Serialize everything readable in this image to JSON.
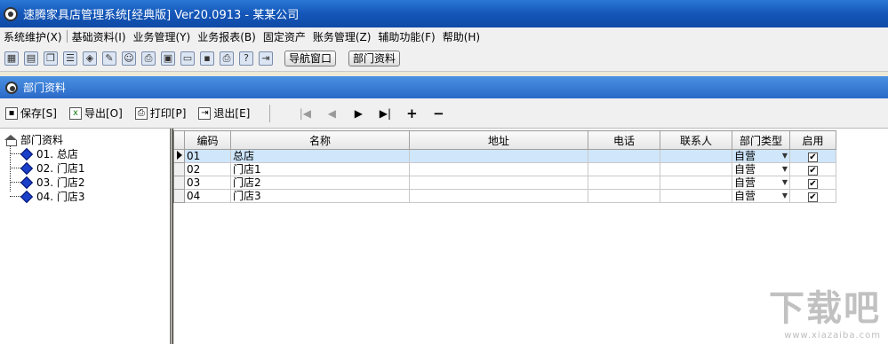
{
  "window": {
    "title": "速腾家具店管理系统[经典版] Ver20.0913  -  某某公司"
  },
  "menu": [
    "系统维护(X)",
    "基础资料(I)",
    "业务管理(Y)",
    "业务报表(B)",
    "固定资产",
    "账务管理(Z)",
    "辅助功能(F)",
    "帮助(H)"
  ],
  "toolbar": {
    "icons": [
      "grid-icon",
      "form-icon",
      "window-icon",
      "list-icon",
      "palette-icon",
      "tools-icon",
      "users-icon",
      "print-preview-icon",
      "folder-icon",
      "screen-icon",
      "save-icon",
      "printer-icon",
      "help-icon",
      "exit-icon"
    ],
    "nav_window_label": "导航窗口",
    "dept_label": "部门资料"
  },
  "subwindow": {
    "title": "部门资料"
  },
  "actions": {
    "save": "保存[S]",
    "export": "导出[O]",
    "print": "打印[P]",
    "exit": "退出[E]"
  },
  "nav": {
    "first": "|◀",
    "prev": "◀",
    "next": "▶",
    "last": "▶|",
    "add": "+",
    "delete": "−"
  },
  "tree": {
    "root": "部门资料",
    "nodes": [
      "01. 总店",
      "02. 门店1",
      "03. 门店2",
      "04. 门店3"
    ]
  },
  "grid": {
    "columns": [
      "编码",
      "名称",
      "地址",
      "电话",
      "联系人",
      "部门类型",
      "启用"
    ],
    "rows": [
      {
        "code": "01",
        "name": "总店",
        "address": "",
        "phone": "",
        "contact": "",
        "type": "自营",
        "enabled": "✔"
      },
      {
        "code": "02",
        "name": "门店1",
        "address": "",
        "phone": "",
        "contact": "",
        "type": "自营",
        "enabled": "✔"
      },
      {
        "code": "03",
        "name": "门店2",
        "address": "",
        "phone": "",
        "contact": "",
        "type": "自营",
        "enabled": "✔"
      },
      {
        "code": "04",
        "name": "门店3",
        "address": "",
        "phone": "",
        "contact": "",
        "type": "自营",
        "enabled": "✔"
      }
    ]
  },
  "watermark": {
    "big": "下载吧",
    "small": "www.xiazaiba.com"
  }
}
